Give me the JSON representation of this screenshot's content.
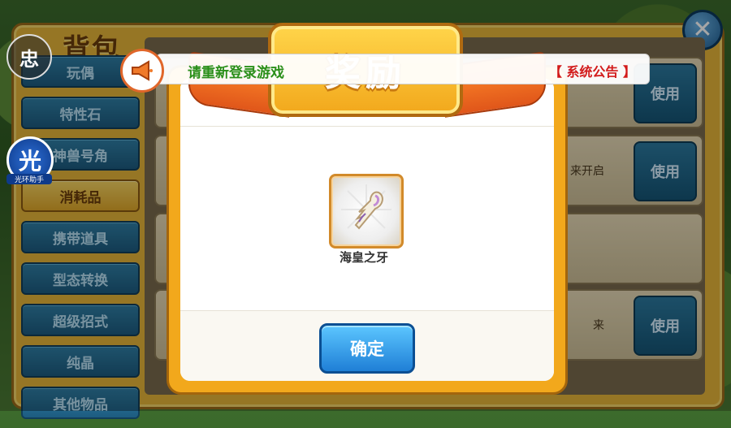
{
  "bag": {
    "title": "背包",
    "close_label": "✕",
    "tabs": [
      {
        "label": "玩偶",
        "active": false
      },
      {
        "label": "特性石",
        "active": false
      },
      {
        "label": "神兽号角",
        "active": false
      },
      {
        "label": "消耗品",
        "active": true
      },
      {
        "label": "携带道具",
        "active": false
      },
      {
        "label": "型态转换",
        "active": false
      },
      {
        "label": "超级招式",
        "active": false
      },
      {
        "label": "纯晶",
        "active": false
      },
      {
        "label": "其他物品",
        "active": false
      }
    ],
    "rows": [
      {
        "use_label": "使用",
        "text": ""
      },
      {
        "use_label": "使用",
        "text": "来开启"
      },
      {
        "use_label": "",
        "text": ""
      },
      {
        "use_label": "使用",
        "text": "来"
      }
    ]
  },
  "floating": {
    "btn_a": "忠",
    "btn_b": "光",
    "btn_b_label": "光环助手"
  },
  "notice": {
    "text": "请重新登录游戏",
    "tag": "【 系统公告 】"
  },
  "dialog": {
    "title": "奖励",
    "item_name": "海皇之牙",
    "confirm_label": "确定"
  }
}
